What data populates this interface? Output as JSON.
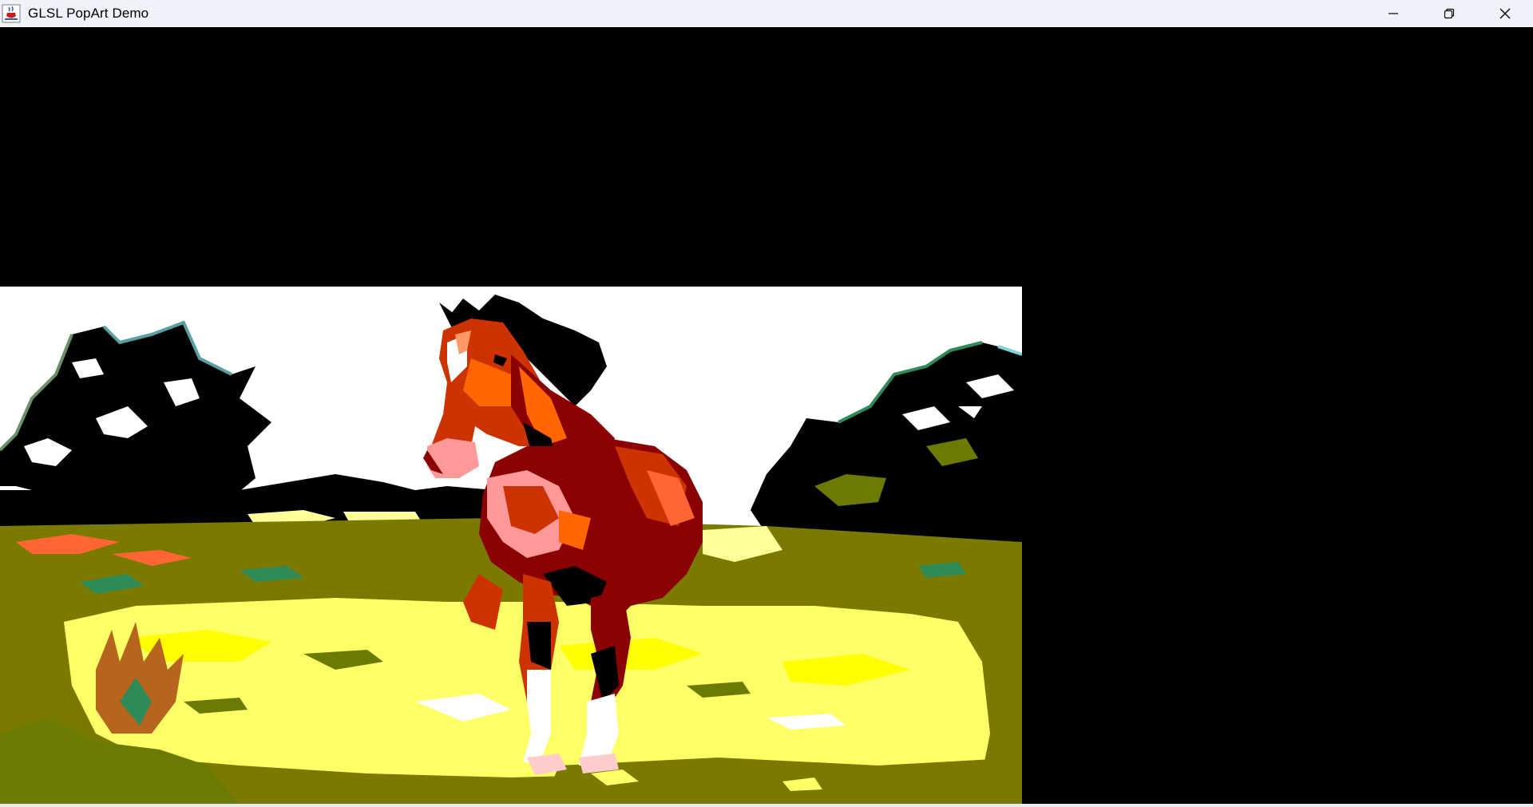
{
  "window": {
    "title": "GLSL PopArt Demo",
    "app_icon": "java-cup-icon",
    "controls": {
      "minimize_icon": "minimize-icon",
      "restore_icon": "restore-icon",
      "close_icon": "close-icon"
    }
  },
  "canvas": {
    "background": "#000000",
    "image": {
      "subject": "horse",
      "effect": "posterized pop art",
      "palette": [
        "#ffffff",
        "#000000",
        "#7a7a00",
        "#ffff66",
        "#cc3300",
        "#8b0000",
        "#ff6600",
        "#008000",
        "#66ff66"
      ]
    }
  }
}
